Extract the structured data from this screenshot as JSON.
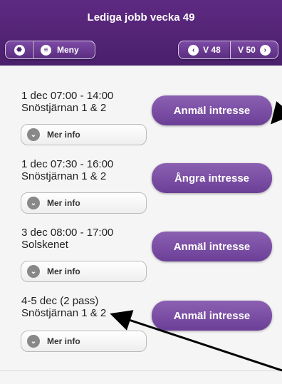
{
  "header": {
    "title": "Lediga jobb vecka 49",
    "menu_label": "Meny",
    "prev_week_label": "V 48",
    "next_week_label": "V 50"
  },
  "shifts": [
    {
      "date_time": "1 dec 07:00 - 14:00",
      "location": "Snöstjärnan 1 & 2",
      "action_label": "Anmäl intresse",
      "more_label": "Mer info"
    },
    {
      "date_time": "1 dec 07:30 - 16:00",
      "location": "Snöstjärnan 1 & 2",
      "action_label": "Ångra intresse",
      "more_label": "Mer info"
    },
    {
      "date_time": "3 dec 08:00 - 17:00",
      "location": "Solskenet",
      "action_label": "Anmäl intresse",
      "more_label": "Mer info"
    },
    {
      "date_time": "4-5 dec (2 pass)",
      "location": "Snöstjärnan 1 & 2",
      "action_label": "Anmäl intresse",
      "more_label": "Mer info"
    }
  ],
  "icons": {
    "settings": "gear-icon",
    "menu": "menu-icon",
    "prev": "chevron-left-icon",
    "next": "chevron-right-icon",
    "more": "chevron-down-icon"
  },
  "colors": {
    "header": "#4a1f6c",
    "button": "#7a4ea3"
  }
}
